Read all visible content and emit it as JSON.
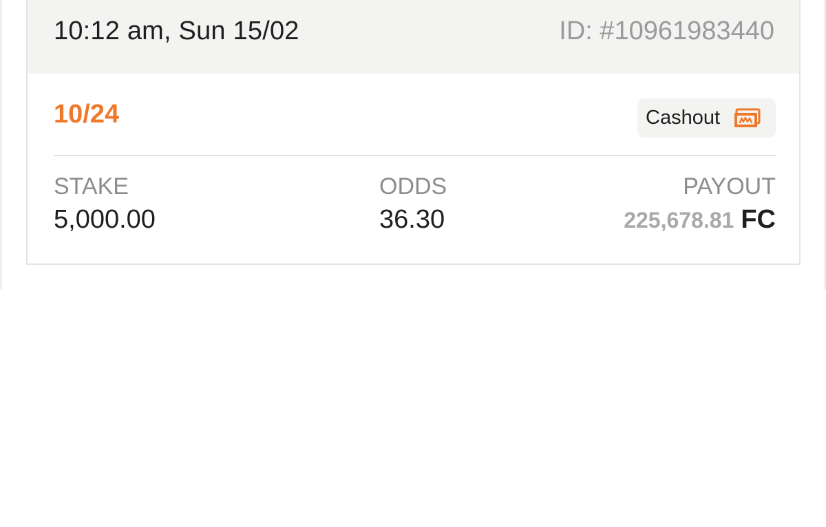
{
  "bet": {
    "datetime": "10:12 am, Sun 15/02",
    "id": "ID: #10961983440",
    "legs": "10/24",
    "cashout_label": "Cashout",
    "cashout_icon": "cashout-money-icon",
    "stake_label": "STAKE",
    "stake_value": "5,000.00",
    "odds_label": "ODDS",
    "odds_value": "36.30",
    "payout_label": "PAYOUT",
    "payout_amount": "225,678.81",
    "payout_currency": "FC"
  },
  "colors": {
    "accent": "#f0782a",
    "header_bg": "#f3f3f1",
    "muted_text": "#9a9a9a",
    "primary_text": "#1f1f1f"
  }
}
